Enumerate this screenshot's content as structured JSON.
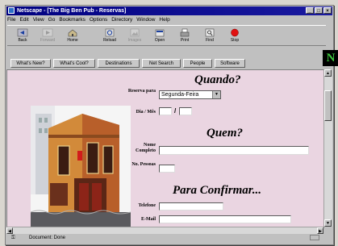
{
  "window": {
    "title": "Netscape - [The Big Ben Pub - Reservas]",
    "controls": [
      "_",
      "□",
      "×"
    ]
  },
  "menu": [
    "File",
    "Edit",
    "View",
    "Go",
    "Bookmarks",
    "Options",
    "Directory",
    "Window",
    "Help"
  ],
  "toolbar": [
    {
      "label": "Back",
      "icon": "back-arrow-icon",
      "enabled": true
    },
    {
      "label": "Forward",
      "icon": "forward-arrow-icon",
      "enabled": false
    },
    {
      "label": "Home",
      "icon": "home-icon",
      "enabled": true
    },
    {
      "label": "Reload",
      "icon": "reload-icon",
      "enabled": true
    },
    {
      "label": "Images",
      "icon": "images-icon",
      "enabled": false
    },
    {
      "label": "Open",
      "icon": "open-icon",
      "enabled": true
    },
    {
      "label": "Print",
      "icon": "print-icon",
      "enabled": true
    },
    {
      "label": "Find",
      "icon": "find-icon",
      "enabled": true
    },
    {
      "label": "Stop",
      "icon": "stop-icon",
      "enabled": true
    }
  ],
  "directory_buttons": [
    "What's New?",
    "What's Cool?",
    "Destinations",
    "Net Search",
    "People",
    "Software"
  ],
  "logo_letter": "N",
  "form": {
    "heading_when": "Quando?",
    "reserve_label": "Reserva para",
    "reserve_value": "Segunda-Feira",
    "day_month_label": "Dia / Mês",
    "date_separator": "/",
    "heading_who": "Quem?",
    "full_name_label": "Nome Completo",
    "people_count_label": "No. Pessoas",
    "heading_confirm": "Para Confirmar...",
    "phone_label": "Telefone",
    "email_label": "E-Mail"
  },
  "status": {
    "text": "Document: Done"
  },
  "colors": {
    "title_bar": "#000080",
    "page_background": "#ead5e1",
    "stop_icon": "#e01010",
    "logo_green": "#3ec43e"
  }
}
